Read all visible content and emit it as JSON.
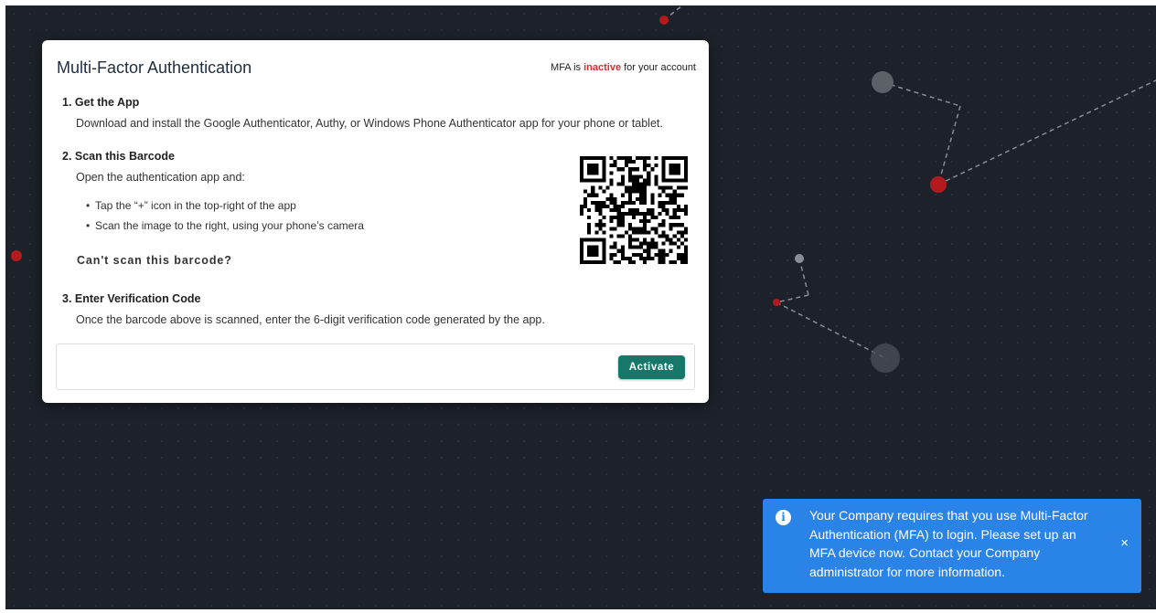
{
  "modal": {
    "title": "Multi-Factor Authentication",
    "status_prefix": "MFA is ",
    "status_value": "inactive",
    "status_suffix": " for your account",
    "status_color": "#d32f2f"
  },
  "steps": {
    "get_app": {
      "heading": "1. Get the App",
      "text": "Download and install the Google Authenticator, Authy, or Windows Phone Authenticator app for your phone or tablet."
    },
    "scan": {
      "heading": "2. Scan this Barcode",
      "text": "Open the authentication app and:",
      "bullets": [
        "Tap the “+” icon in the top-right of the app",
        "Scan the image to the right, using your phone’s camera"
      ],
      "cant_scan_link": "Can't scan this barcode?"
    },
    "verify": {
      "heading": "3. Enter Verification Code",
      "text": "Once the barcode above is scanned, enter the 6-digit verification code generated by the app.",
      "input_value": "",
      "activate_label": "Activate"
    }
  },
  "toast": {
    "icon": "info-icon",
    "message": "Your Company requires that you use Multi-Factor Authentication (MFA) to login. Please set up an MFA device now. Contact your Company administrator for more information.",
    "close_label": "×",
    "color": "#2a84e8"
  },
  "colors": {
    "background": "#1d222a",
    "accent_button": "#17786a",
    "node_red": "#b3191d",
    "node_gray": "#8a8f96"
  }
}
